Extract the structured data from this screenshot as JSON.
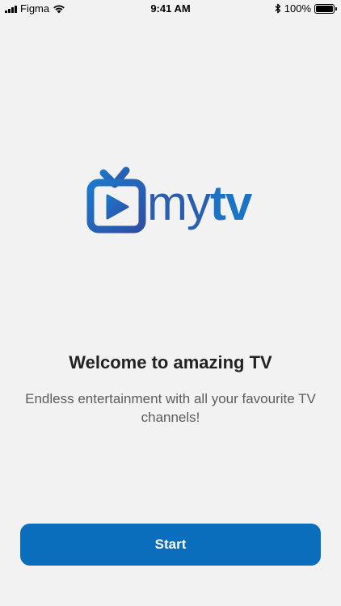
{
  "status_bar": {
    "carrier": "Figma",
    "time": "9:41 AM",
    "battery": "100%",
    "icons": [
      "signal-icon",
      "wifi-icon",
      "bluetooth-icon",
      "battery-icon"
    ]
  },
  "logo": {
    "icon": "tv-play-icon",
    "text_my": "my",
    "text_tv": "tv",
    "colors": {
      "primary": "#1a73c7",
      "secondary": "#2a5fb0"
    }
  },
  "welcome": {
    "title": "Welcome to amazing TV",
    "subtitle": "Endless entertainment with all your favourite TV channels!"
  },
  "actions": {
    "start_label": "Start",
    "color": "#0a6ebd"
  }
}
